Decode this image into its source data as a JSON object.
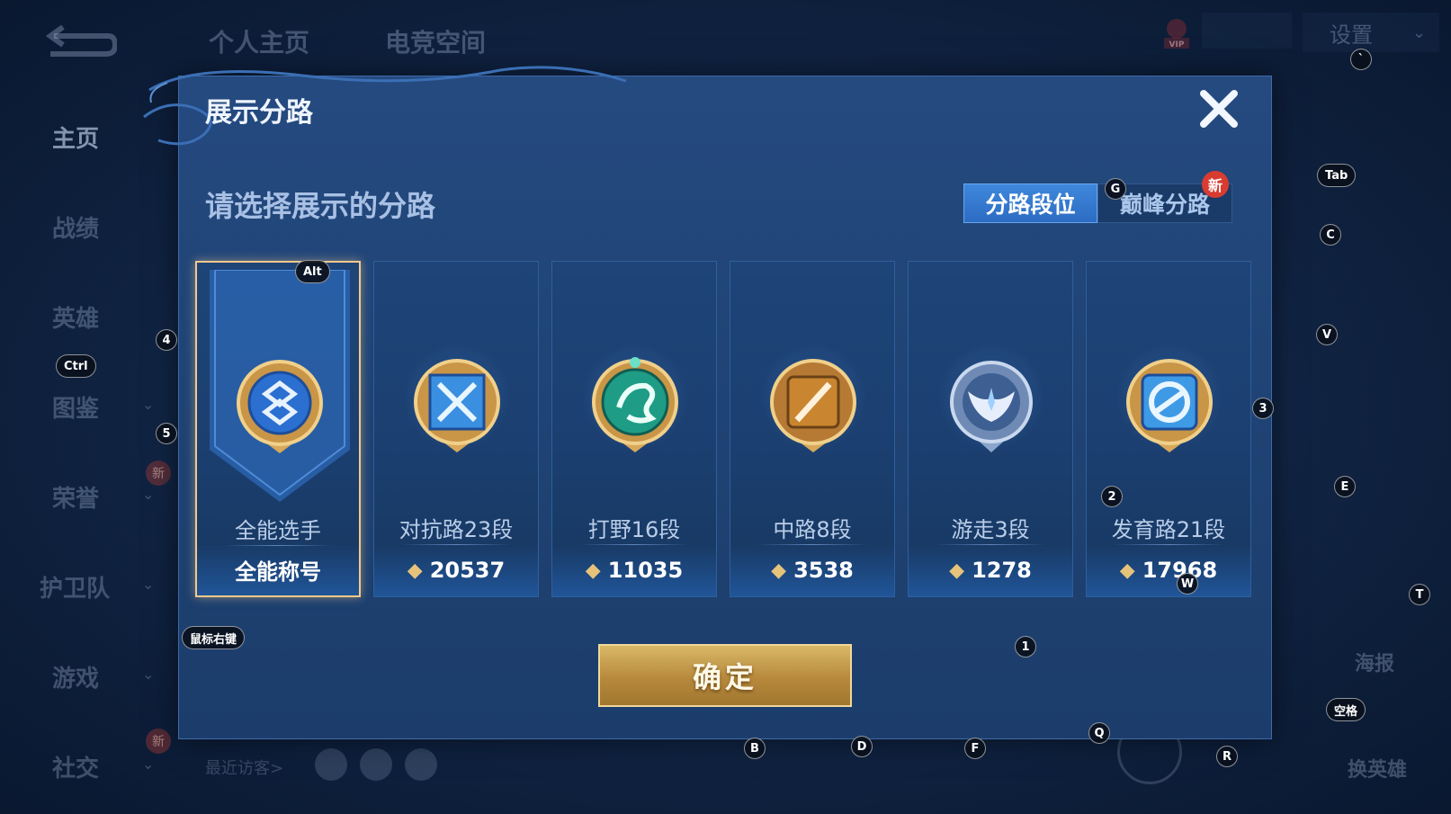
{
  "background": {
    "top_tabs": [
      "个人主页",
      "电竞空间"
    ],
    "settings_label": "设置",
    "vip_label": "VIP",
    "sidebar": [
      {
        "label": "主页"
      },
      {
        "label": "战绩"
      },
      {
        "label": "英雄"
      },
      {
        "label": "图鉴"
      },
      {
        "label": "荣誉"
      },
      {
        "label": "护卫队"
      },
      {
        "label": "游戏"
      },
      {
        "label": "社交"
      }
    ],
    "new_tag": "新",
    "recent_visitors": "最近访客>",
    "right_buttons": [
      "海报",
      "换英雄"
    ]
  },
  "modal": {
    "title": "展示分路",
    "subtitle": "请选择展示的分路",
    "segments": [
      "分路段位",
      "巅峰分路"
    ],
    "new_badge": "新",
    "confirm_label": "确定",
    "cards": [
      {
        "name": "全能选手",
        "footer": "全能称号",
        "points": "",
        "selected": true,
        "color": "#3a7ee0"
      },
      {
        "name": "对抗路23段",
        "footer": "",
        "points": "20537",
        "selected": false,
        "color": "#3a8fe0"
      },
      {
        "name": "打野16段",
        "footer": "",
        "points": "11035",
        "selected": false,
        "color": "#1f9c86"
      },
      {
        "name": "中路8段",
        "footer": "",
        "points": "3538",
        "selected": false,
        "color": "#c9852f"
      },
      {
        "name": "游走3段",
        "footer": "",
        "points": "1278",
        "selected": false,
        "color": "#5e7fb0"
      },
      {
        "name": "发育路21段",
        "footer": "",
        "points": "17968",
        "selected": false,
        "color": "#3f9ae6"
      }
    ]
  },
  "key_hints": {
    "alt": "Alt",
    "ctrl": "Ctrl",
    "tab": "Tab",
    "space": "空格",
    "right_mouse": "鼠标右键",
    "k1": "1",
    "k2": "2",
    "k3": "3",
    "k4": "4",
    "k5": "5",
    "b": "B",
    "c": "C",
    "d": "D",
    "e": "E",
    "f": "F",
    "g": "G",
    "q": "Q",
    "r": "R",
    "t": "T",
    "v": "V",
    "w": "W",
    "backtick": "`"
  }
}
